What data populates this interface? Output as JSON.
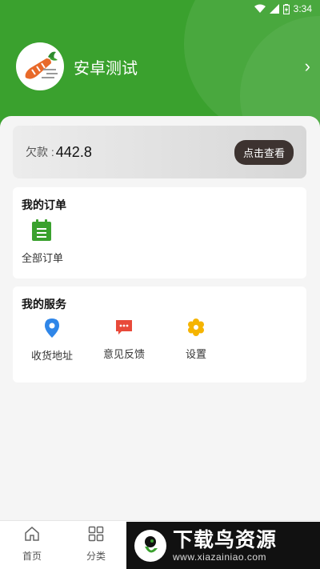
{
  "status_bar": {
    "time": "3:34"
  },
  "profile": {
    "name": "安卓测试",
    "chevron": "›"
  },
  "debt": {
    "label": "欠款 :",
    "amount": "442.8",
    "button": "点击查看"
  },
  "orders": {
    "title": "我的订单",
    "items": [
      {
        "label": "全部订单",
        "icon": "clipboard-icon"
      }
    ]
  },
  "services": {
    "title": "我的服务",
    "items": [
      {
        "label": "收货地址",
        "icon": "location-pin-icon"
      },
      {
        "label": "意见反馈",
        "icon": "feedback-icon"
      },
      {
        "label": "设置",
        "icon": "settings-gear-icon"
      }
    ]
  },
  "tabbar": {
    "tabs": [
      {
        "label": "首页",
        "icon": "home-icon"
      },
      {
        "label": "分类",
        "icon": "grid-icon"
      }
    ]
  },
  "watermark": {
    "title": "下载鸟资源",
    "url": "www.xiazainiao.com"
  },
  "colors": {
    "header_green": "#3aa12e",
    "order_icon_green": "#3aa12e",
    "pin_blue": "#2f86e8",
    "feedback_red": "#e84a3a",
    "gear_yellow": "#f5b400",
    "view_button": "#3d3330"
  }
}
